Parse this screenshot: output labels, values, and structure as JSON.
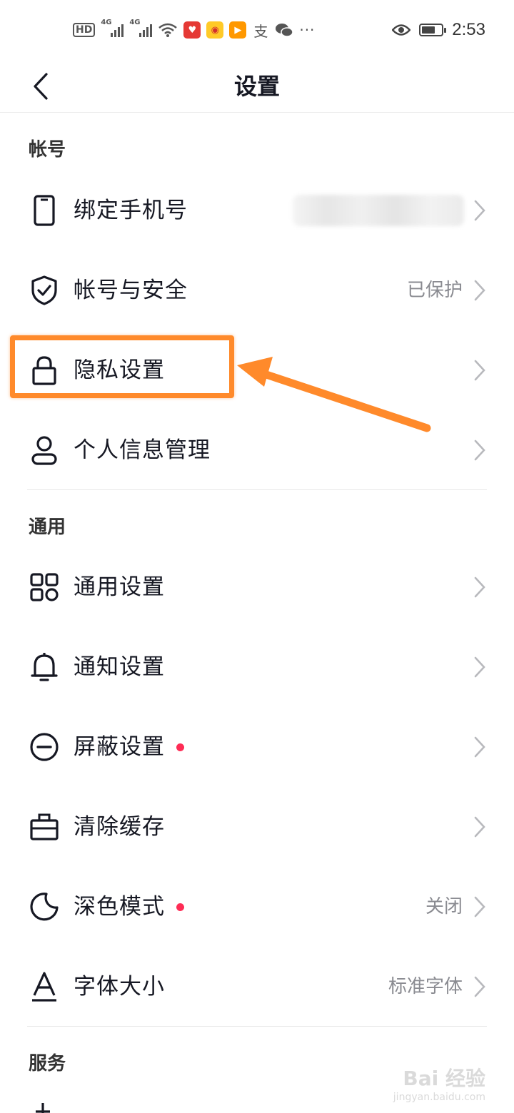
{
  "status_bar": {
    "hd": "HD",
    "sim_label": "4G",
    "time": "2:53",
    "battery_level": 0.7,
    "overflow": "···",
    "app_icons": [
      "red-app-icon",
      "weibo-icon",
      "video-app-icon",
      "alipay-icon",
      "wechat-icon"
    ]
  },
  "navbar": {
    "title": "设置"
  },
  "sections": {
    "account": {
      "title": "帐号",
      "items": [
        {
          "label": "绑定手机号",
          "value": "",
          "icon": "phone-icon"
        },
        {
          "label": "帐号与安全",
          "value": "已保护",
          "icon": "shield-check-icon"
        },
        {
          "label": "隐私设置",
          "value": "",
          "icon": "lock-icon"
        },
        {
          "label": "个人信息管理",
          "value": "",
          "icon": "person-icon"
        }
      ]
    },
    "general": {
      "title": "通用",
      "items": [
        {
          "label": "通用设置",
          "value": "",
          "icon": "grid-icon"
        },
        {
          "label": "通知设置",
          "value": "",
          "icon": "bell-icon"
        },
        {
          "label": "屏蔽设置",
          "value": "",
          "icon": "block-icon",
          "badge": true
        },
        {
          "label": "清除缓存",
          "value": "",
          "icon": "toolbox-icon"
        },
        {
          "label": "深色模式",
          "value": "关闭",
          "icon": "moon-icon",
          "badge": true
        },
        {
          "label": "字体大小",
          "value": "标准字体",
          "icon": "font-icon"
        }
      ]
    },
    "service": {
      "title": "服务"
    }
  },
  "watermark": {
    "line1": "Bai 经验",
    "line2": "jingyan.baidu.com"
  },
  "colors": {
    "accent_badge": "#fe2c55",
    "annotation": "#ff8a2b",
    "text_primary": "#161823",
    "text_secondary": "#8a8b91"
  }
}
